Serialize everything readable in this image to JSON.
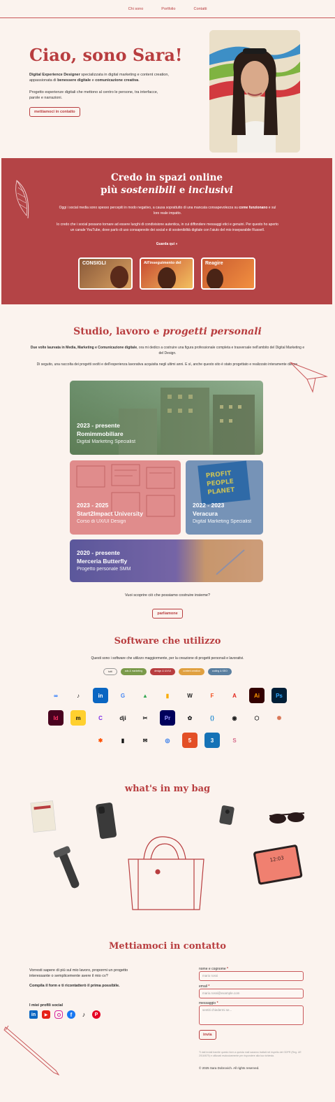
{
  "nav": {
    "items": [
      "Chi sono",
      "Portfolio",
      "Contatti"
    ]
  },
  "hero": {
    "title": "Ciao, sono Sara!",
    "p1_role": "Digital Experience Designer",
    "p1_mid": " specializzata in digital marketing e content creation, appassionata di ",
    "p1_bold2": "benessere digitale",
    "p1_and": " e ",
    "p1_bold3": "comunicazione creativa",
    "p1_end": ".",
    "p2": "Progetto esperienze digitali che mettono al centro le persone, tra interfacce, parole e narrazioni.",
    "cta": "mettiamoci in contatto"
  },
  "band": {
    "title1": "Credo in spazi online",
    "title2_a": "più ",
    "title2_b": "sostenibili",
    "title2_c": " e ",
    "title2_d": "inclusivi",
    "p1_a": "Oggi i social media sono spesso percepiti in modo negativo, a causa soprattutto di una mancata consapevolezza su ",
    "p1_b": "come funzionano",
    "p1_c": " e sul loro reale impatto.",
    "p2": "Io credo che i social possano tornare ad essere luoghi di condivisione autentica, in cui diffondere messaggi etici e genuini. Per questo ho aperto un canale YouTube, dove parlo di uso consapevole dei social e di sostenibilità digitale con l'aiuto del mio inseparabile Russell.",
    "link": "Guarda qui »",
    "thumbs": [
      "CONSIGLI",
      "All'inseguimento del",
      "Reagire"
    ]
  },
  "projects": {
    "title_a": "Studio, lavoro e ",
    "title_b": "progetti personali",
    "p1_b": "Due volte laureata in Media, Marketing e Comunicazione digitale",
    "p1_rest": ", ora mi dedico a costruire una figura professionale completa e trasversale nell'ambito del Digital Marketing e del Design.",
    "p2": "Di seguito, una raccolta dei progetti svolti e dell'esperienza lavorativa acquisita negli ultimi anni. E sì, anche questo sito è stato progettato e realizzato interamente da me.",
    "cards": [
      {
        "years": "2023 - presente",
        "name": "Romimmobiliare",
        "role": "Digital Marketing Specialist"
      },
      {
        "years": "2023 - 2025",
        "name": "Start2Impact University",
        "role": "Corso di UX/UI Design"
      },
      {
        "years": "2022 - 2023",
        "name": "Veracura",
        "role": "Digital Marketing Specialist"
      },
      {
        "years": "2020 - presente",
        "name": "Merceria Butterfly",
        "role": "Progetto personale SMM"
      }
    ],
    "question": "Vuoi scoprire ciò che possiamo costruire insieme?",
    "cta": "parliamone"
  },
  "software": {
    "title": "Software che utilizzo",
    "subtitle": "Questi sono i software che utilizzo maggiormente, per la creazione di progetti personali e lavorativi.",
    "filters": [
      "tutti",
      "ads & marketing",
      "design & UX/UI",
      "content creation",
      "coding & SEO"
    ],
    "filter_colors": [
      "#fbf3ee",
      "#7a9a4a",
      "#b83d3f",
      "#e0a040",
      "#5a7fa0"
    ],
    "row1": [
      "Meta",
      "TikTok",
      "LinkedIn",
      "Google",
      "Google Ads",
      "Analytics",
      "WordPress",
      "Figma",
      "Adobe",
      "Illustrator",
      "Photoshop"
    ],
    "row2": [
      "InDesign",
      "Miro",
      "Canva",
      "DJI",
      "CapCut",
      "Premiere Pro",
      "ChatGPT",
      "VS Code",
      "Copilot",
      "CodeSandbox",
      "Claude"
    ],
    "row3": [
      "Zapier",
      "Notion",
      "Mailchimp",
      "GitHub",
      "HTML5",
      "CSS3",
      "Scribble"
    ],
    "row1_labels": [
      "∞",
      "♪",
      "in",
      "G",
      "▲",
      "▮",
      "W",
      "F",
      "A",
      "Ai",
      "Ps"
    ],
    "row2_labels": [
      "Id",
      "m",
      "C",
      "dji",
      "✂",
      "Pr",
      "✿",
      "⟨⟩",
      "◉",
      "⬡",
      "✺"
    ],
    "row3_labels": [
      "✱",
      "▮",
      "✉",
      "◎",
      "5",
      "3",
      "S"
    ]
  },
  "bag": {
    "title": "what's in my bag",
    "tablet_time": "12:03"
  },
  "contact": {
    "title": "Mettiamoci in contatto",
    "p1": "Vorresti sapere di più sul mio lavoro, propormi un progetto interessante o semplicemente avere il mio cv?",
    "p2": "Compila il form e ti ricontatterò il prima possibile.",
    "social_label": "I miei profili social",
    "name_label": "nome e cognome",
    "name_ph": "mario rossi",
    "email_label": "email",
    "email_ph": "mario.rossi@example.com",
    "msg_label": "messaggio",
    "msg_ph": "sentiti chiedermi se...",
    "submit": "invia",
    "privacy": "Ti dati inviati tramite questo form a questa mail saranno trattati nel rispetto del GDPR (Reg. UE 2016/679) e utilizzati esclusivamente per rispondere alla tua richiesta.",
    "copyright": "© 2025 Sara Dobrovich. All rights reserved."
  }
}
